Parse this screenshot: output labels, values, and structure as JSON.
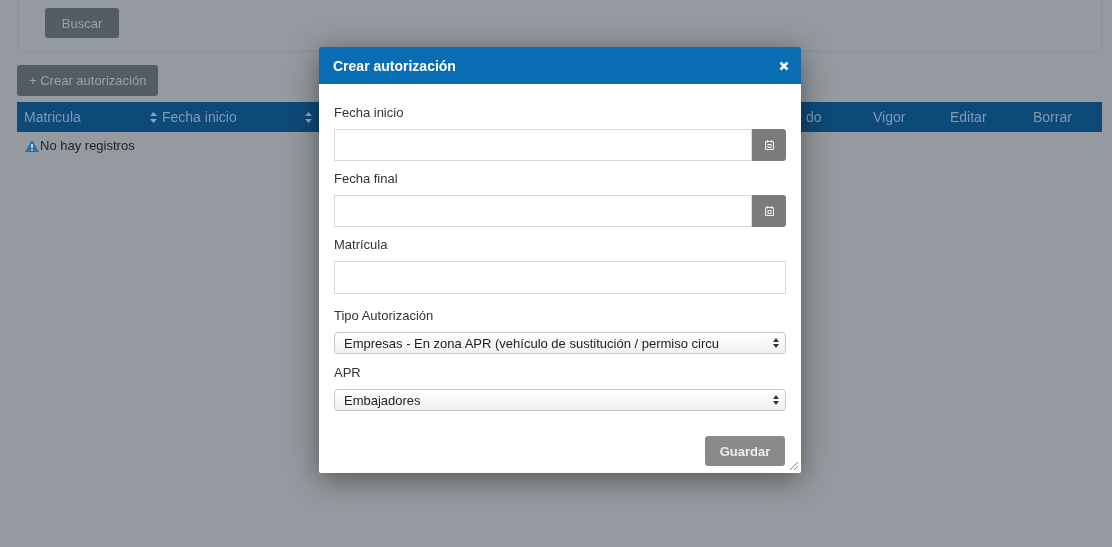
{
  "search_panel": {
    "button": "Buscar"
  },
  "create_button": "+ Crear autorización",
  "table": {
    "columns": [
      {
        "label": "Matricula",
        "sortable": false
      },
      {
        "label": "Fecha inicio",
        "sortable": true
      },
      {
        "sortable": true
      },
      {
        "label": "do",
        "sortable": false
      },
      {
        "label": "Vigor",
        "sortable": false
      },
      {
        "label": "Editar",
        "sortable": false
      },
      {
        "label": "Borrar",
        "sortable": false
      }
    ],
    "empty_message": "No hay registros"
  },
  "dialog": {
    "title": "Crear autorización",
    "fields": [
      {
        "kind": "date",
        "label": "Fecha inicio"
      },
      {
        "kind": "date",
        "label": "Fecha final"
      },
      {
        "kind": "text",
        "label": "Matrícula"
      },
      {
        "kind": "select",
        "label": "Tipo Autorización",
        "value": "Empresas - En zona APR (vehículo de sustitución / permiso circu"
      },
      {
        "kind": "select",
        "label": "APR",
        "value": "Embajadores"
      }
    ],
    "button": "Guardar"
  }
}
